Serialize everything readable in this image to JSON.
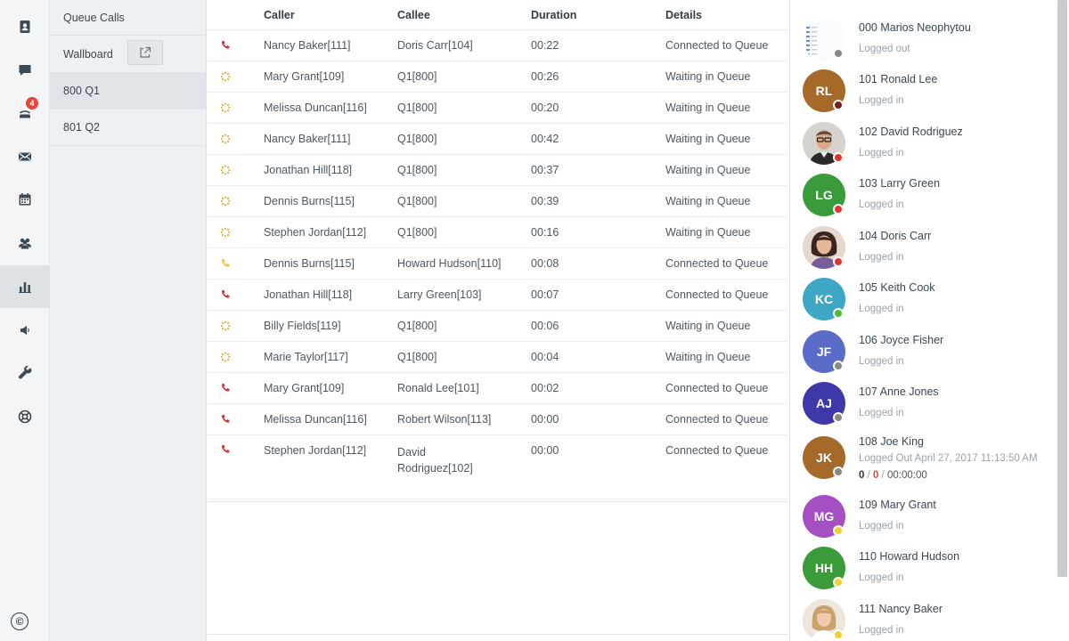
{
  "rail": {
    "items": [
      {
        "icon": "contacts-icon"
      },
      {
        "icon": "chat-icon"
      },
      {
        "icon": "calls-icon",
        "badge": "4"
      },
      {
        "icon": "mail-icon"
      },
      {
        "icon": "calendar-icon"
      },
      {
        "icon": "people-icon"
      },
      {
        "icon": "chart-icon",
        "active": true
      },
      {
        "icon": "speaker-icon"
      },
      {
        "icon": "wrench-icon"
      },
      {
        "icon": "help-icon"
      }
    ],
    "copyright_symbol": "©"
  },
  "subnav": {
    "title": "Queue Calls",
    "wallboard_label": "Wallboard",
    "queues": [
      {
        "label": "800 Q1",
        "selected": true
      },
      {
        "label": "801 Q2",
        "selected": false
      }
    ]
  },
  "calls": {
    "headers": {
      "caller": "Caller",
      "callee": "Callee",
      "duration": "Duration",
      "details": "Details"
    },
    "rows": [
      {
        "state": "connected-red",
        "caller": "Nancy Baker[111]",
        "callee": "Doris Carr[104]",
        "duration": "00:22",
        "details": "Connected to Queue"
      },
      {
        "state": "waiting",
        "caller": "Mary Grant[109]",
        "callee": "Q1[800]",
        "duration": "00:26",
        "details": "Waiting in Queue"
      },
      {
        "state": "waiting",
        "caller": "Melissa Duncan[116]",
        "callee": "Q1[800]",
        "duration": "00:20",
        "details": "Waiting in Queue"
      },
      {
        "state": "waiting",
        "caller": "Nancy Baker[111]",
        "callee": "Q1[800]",
        "duration": "00:42",
        "details": "Waiting in Queue"
      },
      {
        "state": "waiting",
        "caller": "Jonathan Hill[118]",
        "callee": "Q1[800]",
        "duration": "00:37",
        "details": "Waiting in Queue"
      },
      {
        "state": "waiting",
        "caller": "Dennis Burns[115]",
        "callee": "Q1[800]",
        "duration": "00:39",
        "details": "Waiting in Queue"
      },
      {
        "state": "waiting",
        "caller": "Stephen Jordan[112]",
        "callee": "Q1[800]",
        "duration": "00:16",
        "details": "Waiting in Queue"
      },
      {
        "state": "connected-yellow",
        "caller": "Dennis Burns[115]",
        "callee": "Howard Hudson[110]",
        "duration": "00:08",
        "details": "Connected to Queue"
      },
      {
        "state": "connected-red",
        "caller": "Jonathan Hill[118]",
        "callee": "Larry Green[103]",
        "duration": "00:07",
        "details": "Connected to Queue"
      },
      {
        "state": "waiting",
        "caller": "Billy Fields[119]",
        "callee": "Q1[800]",
        "duration": "00:06",
        "details": "Waiting in Queue"
      },
      {
        "state": "waiting",
        "caller": "Marie Taylor[117]",
        "callee": "Q1[800]",
        "duration": "00:04",
        "details": "Waiting in Queue"
      },
      {
        "state": "connected-red",
        "caller": "Mary Grant[109]",
        "callee": "Ronald Lee[101]",
        "duration": "00:02",
        "details": "Connected to Queue"
      },
      {
        "state": "connected-red",
        "caller": "Melissa Duncan[116]",
        "callee": "Robert Wilson[113]",
        "duration": "00:00",
        "details": "Connected to Queue"
      },
      {
        "state": "connected-red",
        "caller": "Stephen Jordan[112]",
        "callee": "David Rodriguez[102]",
        "duration": "00:00",
        "details": "Connected to Queue"
      }
    ]
  },
  "agents": [
    {
      "name": "000 Marios Neophytou",
      "status": "Logged out",
      "initials": "",
      "avatar_color": "#ffffff",
      "photo": "grid",
      "dot": "#888888"
    },
    {
      "name": "101 Ronald Lee",
      "status": "Logged in",
      "initials": "RL",
      "avatar_color": "#a5692a",
      "dot": "#7a1b1b"
    },
    {
      "name": "102 David Rodriguez",
      "status": "Logged in",
      "initials": "",
      "avatar_color": "#c9c3bc",
      "photo": "man",
      "dot": "#e5312b"
    },
    {
      "name": "103 Larry Green",
      "status": "Logged in",
      "initials": "LG",
      "avatar_color": "#3a9b3a",
      "dot": "#e5312b"
    },
    {
      "name": "104 Doris Carr",
      "status": "Logged in",
      "initials": "",
      "avatar_color": "#d9c2b4",
      "photo": "woman",
      "dot": "#e5312b"
    },
    {
      "name": "105 Keith Cook",
      "status": "Logged in",
      "initials": "KC",
      "avatar_color": "#3fa7c6",
      "dot": "#4cbb2f"
    },
    {
      "name": "106 Joyce Fisher",
      "status": "Logged in",
      "initials": "JF",
      "avatar_color": "#5b6bc8",
      "dot": "#888888"
    },
    {
      "name": "107 Anne Jones",
      "status": "Logged in",
      "initials": "AJ",
      "avatar_color": "#3f38a8",
      "dot": "#888888"
    },
    {
      "name": "108 Joe King",
      "status": "Logged Out April 27, 2017 11:13:50 AM",
      "initials": "JK",
      "avatar_color": "#a5692a",
      "dot": "#888888",
      "counts": {
        "answered": "0",
        "missed": "0",
        "time": "00:00:00"
      }
    },
    {
      "name": "109 Mary Grant",
      "status": "Logged in",
      "initials": "MG",
      "avatar_color": "#a54fc2",
      "dot": "#f0d22e"
    },
    {
      "name": "110 Howard Hudson",
      "status": "Logged in",
      "initials": "HH",
      "avatar_color": "#3a9b3a",
      "dot": "#f0d22e"
    },
    {
      "name": "111 Nancy Baker",
      "status": "Logged in",
      "initials": "",
      "avatar_color": "#e3cfb8",
      "photo": "woman-blonde",
      "dot": "#f0d22e"
    }
  ],
  "colors": {
    "waiting": "#f0a020",
    "connected_red": "#d8302a",
    "connected_yellow": "#f0c419"
  }
}
